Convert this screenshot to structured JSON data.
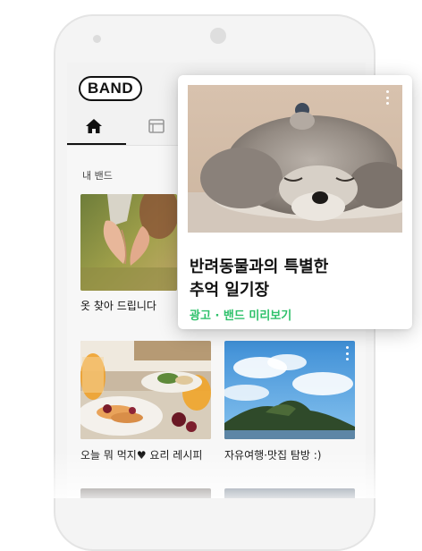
{
  "app": {
    "logo_text": "BAND"
  },
  "tabs": [
    {
      "icon": "home-icon",
      "selected": true
    },
    {
      "icon": "board-icon",
      "selected": false
    }
  ],
  "section": {
    "title": "내 밴드"
  },
  "bands": [
    {
      "caption": "옷 찾아 드립니다",
      "image": "hands-heart"
    },
    {
      "caption": "오늘 뭐 먹지♥ 요리 레시피",
      "image": "breakfast-table"
    },
    {
      "caption": "자유여행·맛집 탐방 :)",
      "image": "sky-island"
    }
  ],
  "ad": {
    "title_line1": "반려동물과의 특별한",
    "title_line2": "추억 일기장",
    "meta": "광고 · 밴드 미리보기",
    "image": "sleeping-dog"
  },
  "colors": {
    "accent_green": "#2fc16b",
    "text": "#111111"
  }
}
